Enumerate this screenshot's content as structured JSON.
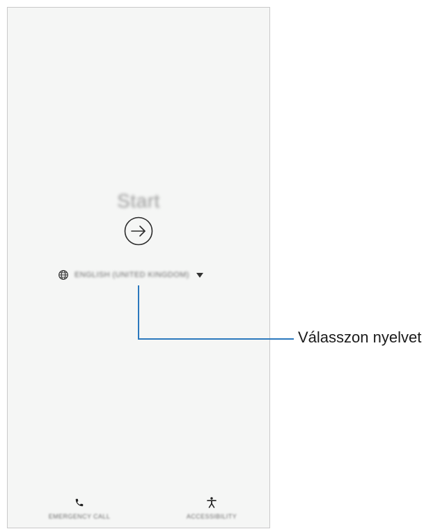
{
  "screen": {
    "title": "Start",
    "start_button_icon": "arrow-right-circle-icon",
    "language": {
      "icon": "globe-icon",
      "label": "ENGLISH (UNITED KINGDOM)",
      "dropdown_icon": "caret-down-icon"
    },
    "bottom_actions": [
      {
        "label": "EMERGENCY CALL",
        "icon": "phone-icon"
      },
      {
        "label": "ACCESSIBILITY",
        "icon": "accessibility-icon"
      }
    ]
  },
  "callout": {
    "text": "Válasszon nyelvet",
    "color": "#2a78bd"
  }
}
